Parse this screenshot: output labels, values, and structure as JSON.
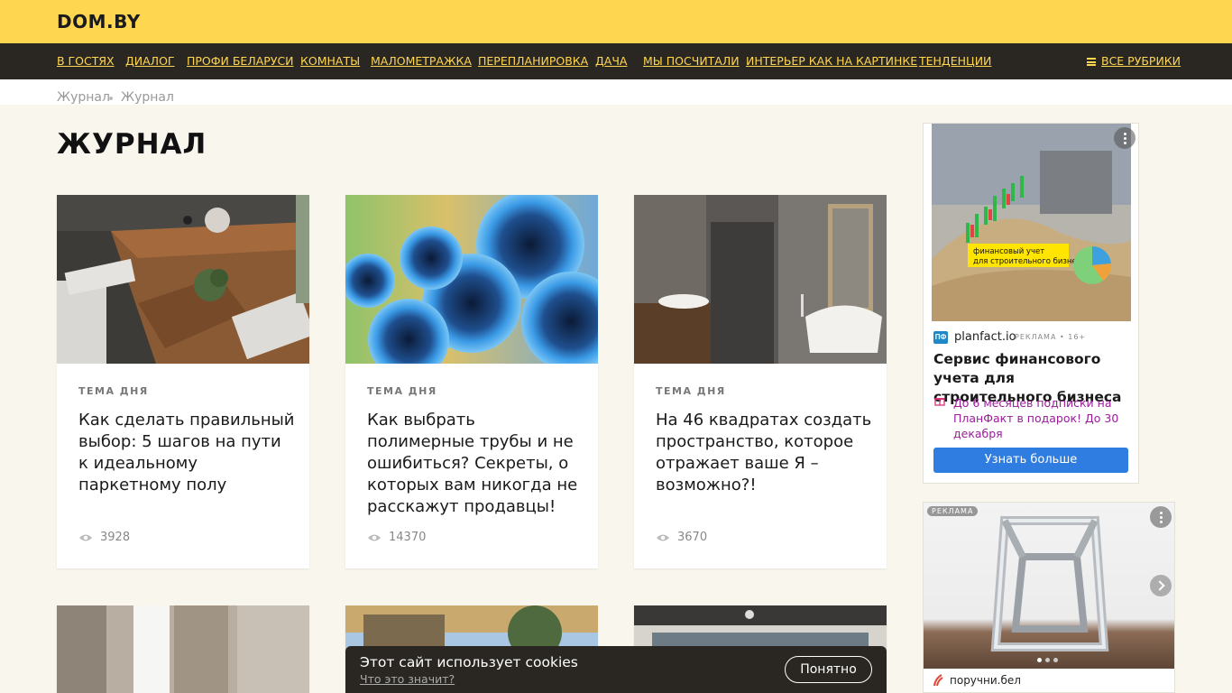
{
  "header": {
    "logo": "DOM.BY"
  },
  "nav": {
    "items": [
      {
        "label": "В ГОСТЯХ"
      },
      {
        "label": "ДИАЛОГ"
      },
      {
        "label": "ПРОФИ БЕЛАРУСИ"
      },
      {
        "label": "КОМНАТЫ"
      },
      {
        "label": "МАЛОМЕТРАЖКА"
      },
      {
        "label": "ПЕРЕПЛАНИРОВКА"
      },
      {
        "label": "ДАЧА"
      },
      {
        "label": "МЫ ПОСЧИТАЛИ"
      },
      {
        "label": "ИНТЕРЬЕР КАК НА КАРТИНКЕ"
      },
      {
        "label": "ТЕНДЕНЦИИ"
      }
    ],
    "all_label": "ВСЕ РУБРИКИ"
  },
  "breadcrumbs": [
    "Журнал",
    "Журнал"
  ],
  "page_title": "ЖУРНАЛ",
  "cards": [
    {
      "tag": "ТЕМА ДНЯ",
      "title": "Как сделать правильный выбор: 5 шагов на пути к идеальному паркетному полу",
      "views": "3928"
    },
    {
      "tag": "ТЕМА ДНЯ",
      "title": "Как выбрать полимерные трубы и не ошибиться? Секреты, о которых вам никогда не расскажут продавцы!",
      "views": "14370"
    },
    {
      "tag": "ТЕМА ДНЯ",
      "title": "На 46 квадратах создать пространство, которое отражает ваше Я – возможно?!",
      "views": "3670"
    }
  ],
  "ad1": {
    "image_caption_line1": "финансовый учет",
    "image_caption_line2": "для строительного бизнеса",
    "badge": "ПФ",
    "domain": "planfact.io",
    "label": "РЕКЛАМА • 16+",
    "title": "Сервис финансового учета для строительного бизнеса",
    "promo": "До 6 месяцев подписки на ПланФакт в подарок! До 30 декабря",
    "button": "Узнать больше"
  },
  "ad2": {
    "label": "РЕКЛАМА",
    "domain": "поручни.бел"
  },
  "cookie": {
    "text": "Этот сайт использует cookies",
    "link": "Что это значит?",
    "button": "Понятно"
  },
  "colors": {
    "accent_yellow": "#ffd650",
    "nav_dark": "#2a2722",
    "page_bg": "#f9f6ee",
    "ad_button_blue": "#2f7de1",
    "promo_purple": "#9a1c9a"
  }
}
